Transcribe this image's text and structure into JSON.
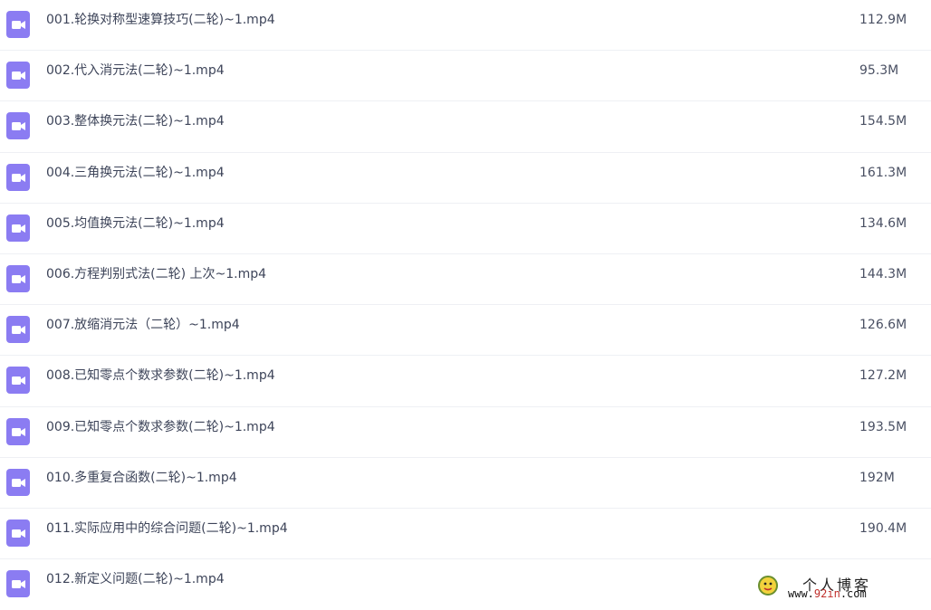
{
  "icon": "video-file-icon",
  "colors": {
    "icon_bg": "#8b7cf2",
    "text": "#3d4459",
    "divider": "#eef0f4"
  },
  "files": [
    {
      "name": "001.轮换对称型速算技巧(二轮)~1.mp4",
      "size": "112.9M"
    },
    {
      "name": "002.代入消元法(二轮)~1.mp4",
      "size": "95.3M"
    },
    {
      "name": "003.整体换元法(二轮)~1.mp4",
      "size": "154.5M"
    },
    {
      "name": "004.三角换元法(二轮)~1.mp4",
      "size": "161.3M"
    },
    {
      "name": "005.均值换元法(二轮)~1.mp4",
      "size": "134.6M"
    },
    {
      "name": "006.方程判别式法(二轮) 上次~1.mp4",
      "size": "144.3M"
    },
    {
      "name": "007.放缩消元法（二轮）~1.mp4",
      "size": "126.6M"
    },
    {
      "name": "008.已知零点个数求参数(二轮)~1.mp4",
      "size": "127.2M"
    },
    {
      "name": "009.已知零点个数求参数(二轮)~1.mp4",
      "size": "193.5M"
    },
    {
      "name": "010.多重复合函数(二轮)~1.mp4",
      "size": "192M"
    },
    {
      "name": "011.实际应用中的综合问题(二轮)~1.mp4",
      "size": "190.4M"
    },
    {
      "name": "012.新定义问题(二轮)~1.mp4",
      "size": ""
    }
  ],
  "watermark": {
    "title": "个人博客",
    "url_prefix": "www.",
    "url_highlight": "92in",
    "url_suffix": ".com"
  }
}
